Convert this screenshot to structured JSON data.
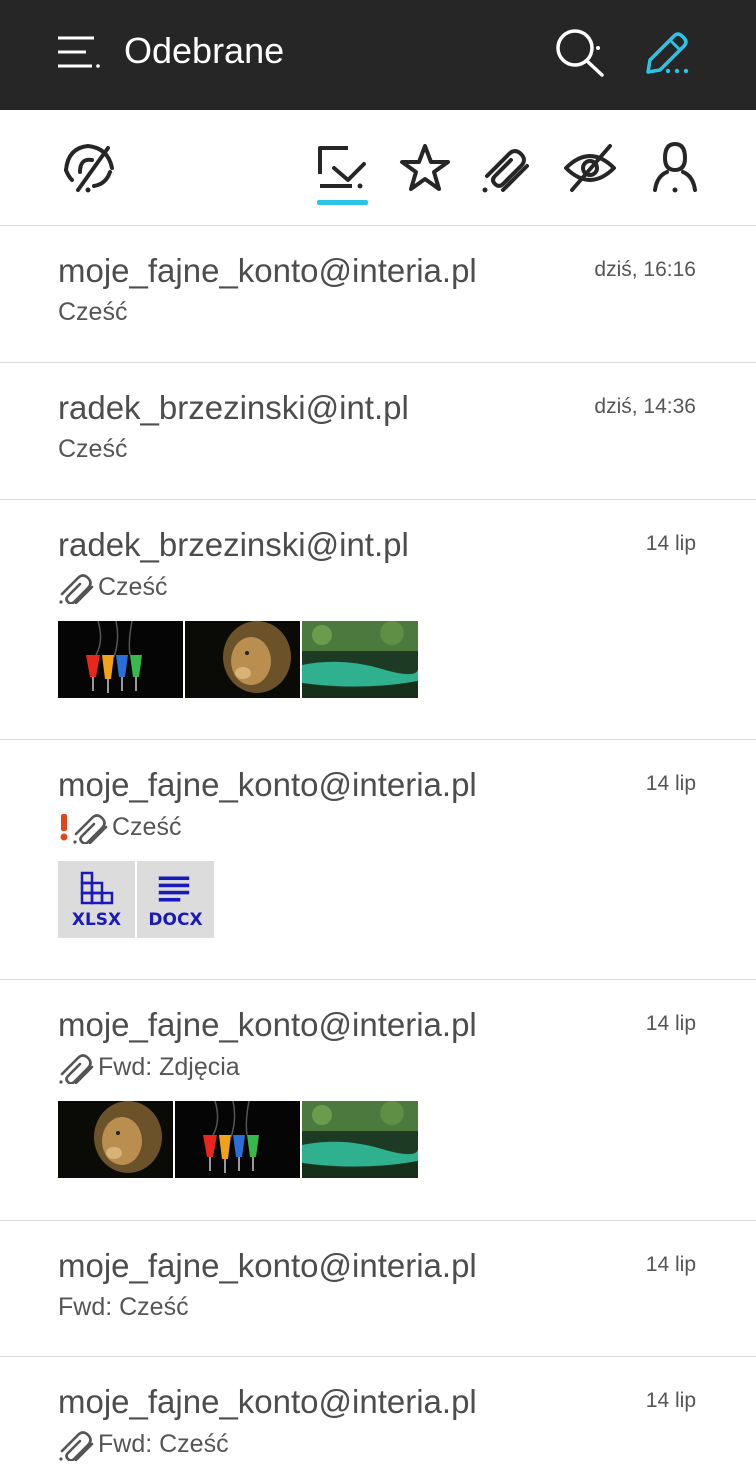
{
  "appbar": {
    "title": "Odebrane",
    "menu_icon": "menu-icon",
    "search_icon": "search-icon",
    "compose_icon": "compose-icon",
    "accent": "#2bc4e6"
  },
  "filters": [
    {
      "name": "unread-filter",
      "icon": "eye-off-alt-icon"
    },
    {
      "name": "inbox-filter",
      "icon": "inbox-check-icon",
      "active": true
    },
    {
      "name": "starred-filter",
      "icon": "star-icon"
    },
    {
      "name": "attachments-filter",
      "icon": "paperclip-icon"
    },
    {
      "name": "hidden-filter",
      "icon": "eye-off-icon"
    },
    {
      "name": "contacts-filter",
      "icon": "person-icon"
    }
  ],
  "mails": [
    {
      "from": "moje_fajne_konto@interia.pl",
      "date": "dziś, 16:16",
      "subject": "Cześć"
    },
    {
      "from": "radek_brzezinski@int.pl",
      "date": "dziś, 14:36",
      "subject": "Cześć"
    },
    {
      "from": "radek_brzezinski@int.pl",
      "date": "14 lip",
      "subject": "Cześć",
      "attachment": true,
      "thumbnails": [
        "drinks-image",
        "lion-image",
        "river-image"
      ]
    },
    {
      "from": "moje_fajne_konto@interia.pl",
      "date": "14 lip",
      "subject": "Cześć",
      "attachment": true,
      "important": true,
      "files": [
        "XLSX",
        "DOCX"
      ]
    },
    {
      "from": "moje_fajne_konto@interia.pl",
      "date": "14 lip",
      "subject": "Fwd: Zdjęcia",
      "attachment": true,
      "thumbnails": [
        "lion-image",
        "drinks-image",
        "river-image"
      ]
    },
    {
      "from": "moje_fajne_konto@interia.pl",
      "date": "14 lip",
      "subject": "Fwd: Cześć"
    },
    {
      "from": "moje_fajne_konto@interia.pl",
      "date": "14 lip",
      "subject": "Fwd: Cześć",
      "attachment": true
    }
  ]
}
